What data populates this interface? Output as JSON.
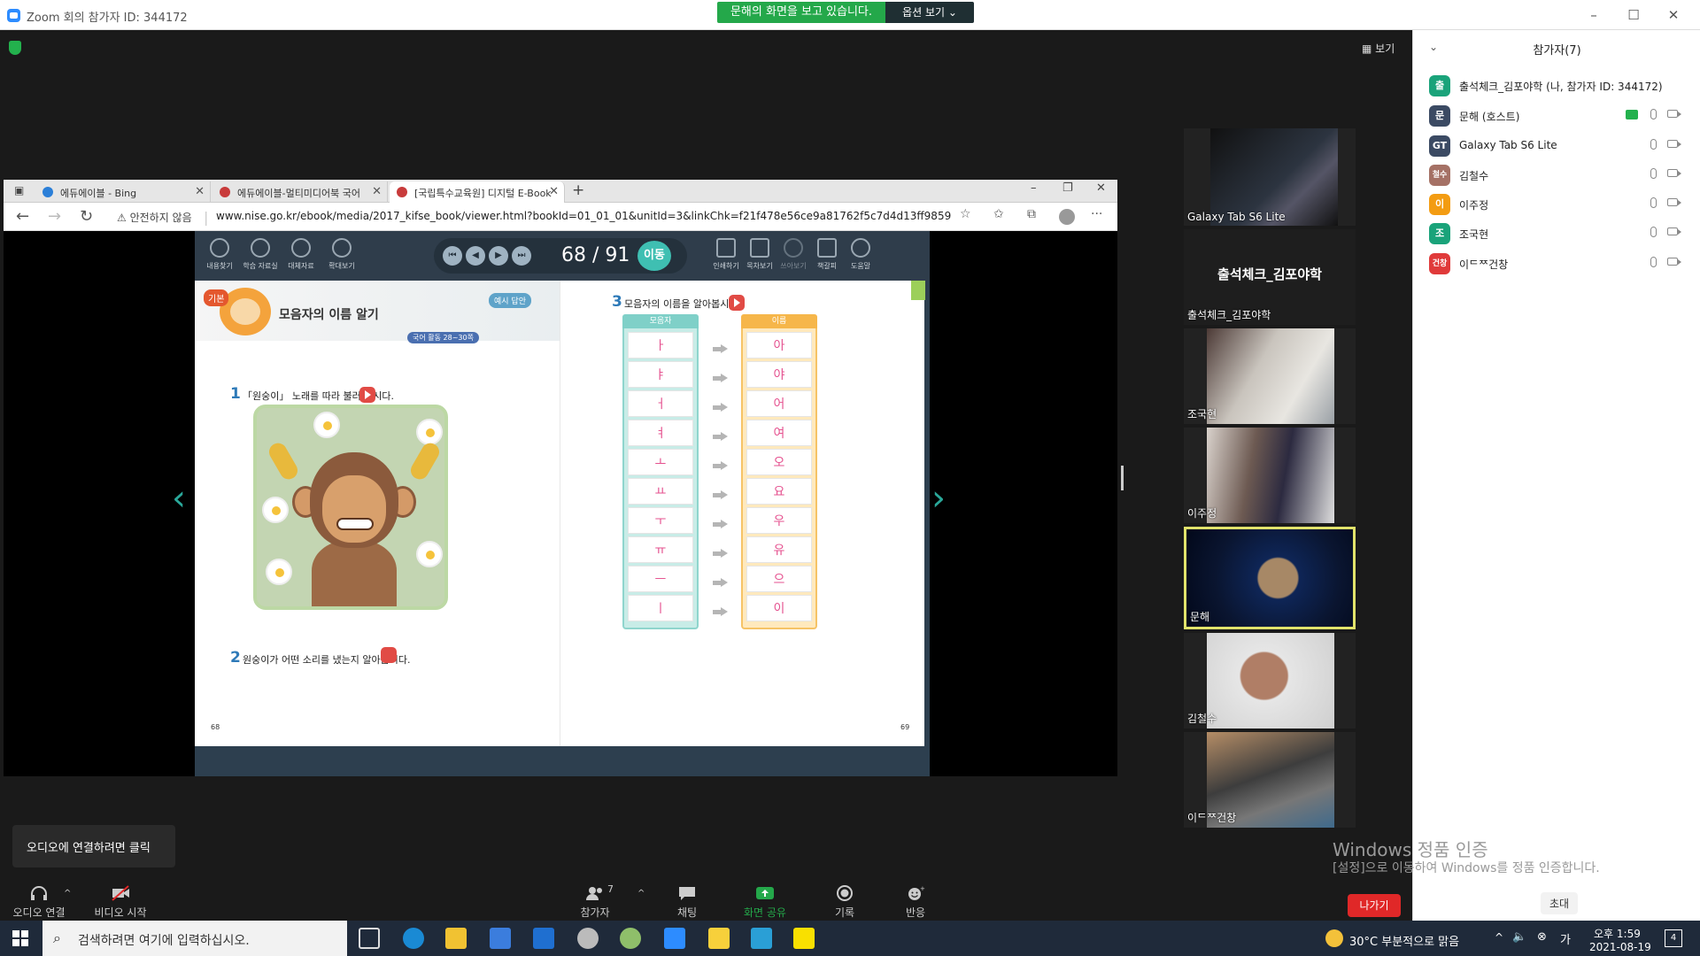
{
  "window": {
    "title": "Zoom 회의 참가자 ID: 344172",
    "share_banner": "문해의 화면을 보고 있습니다.",
    "view_options": "옵션 보기 ⌄",
    "view_label": "보기"
  },
  "browser": {
    "tabs": [
      {
        "label": "에듀에이블 - Bing"
      },
      {
        "label": "에듀에이블-멀티미디어북 국어"
      },
      {
        "label": "[국립특수교육원] 디지털 E-Book"
      }
    ],
    "security_warning": "안전하지 않음",
    "url": "www.nise.go.kr/ebook/media/2017_kifse_book/viewer.html?bookId=01_01_01&unitId=3&linkChk=f21f478e56ce9a81762f5c7d4d13ff9859507d6624cd2398f1892f..."
  },
  "ebook": {
    "tools_left": [
      "내용찾기",
      "학습 자료실",
      "대체자료",
      "확대보기"
    ],
    "tools_right": [
      "인쇄하기",
      "목차보기",
      "쓰아보기",
      "책갈피",
      "도움말"
    ],
    "page_current": "68",
    "page_total": "91",
    "page_display": "68 / 91",
    "go_label": "이동",
    "left_page": {
      "badge": "기본",
      "title": "모음자의 이름 알기",
      "answer_tag": "예시 답안",
      "hours": "국어 활동 28~30쪽",
      "q1_num": "1",
      "q1_text": "「원숭이」 노래를 따라 불러 봅시다.",
      "q2_num": "2",
      "q2_text": "원숭이가 어떤 소리를 냈는지 알아봅시다.",
      "page_no": "68"
    },
    "right_page": {
      "q3_num": "3",
      "q3_text": "모음자의 이름을 알아봅시다.",
      "col_vowel": "모음자",
      "col_name": "이름",
      "vowels": [
        "ㅏ",
        "ㅑ",
        "ㅓ",
        "ㅕ",
        "ㅗ",
        "ㅛ",
        "ㅜ",
        "ㅠ",
        "ㅡ",
        "ㅣ"
      ],
      "names": [
        "아",
        "야",
        "어",
        "여",
        "오",
        "요",
        "우",
        "유",
        "으",
        "이"
      ],
      "page_no": "69"
    }
  },
  "videos": [
    {
      "name": "Galaxy Tab S6 Lite"
    },
    {
      "name": "출석체크_김포야학",
      "big": "출석체크_김포야학"
    },
    {
      "name": "조국현"
    },
    {
      "name": "이주정"
    },
    {
      "name": "문해"
    },
    {
      "name": "김철수"
    },
    {
      "name": "이ᄃᄍ건창"
    }
  ],
  "participants": {
    "title": "참가자(7)",
    "list": [
      {
        "avatar": "출",
        "name": "출석체크_김포야학 (나, 참가자 ID: 344172)",
        "color": "#1aa37a"
      },
      {
        "avatar": "문",
        "name": "문해 (호스트)",
        "color": "#3b4a63"
      },
      {
        "avatar": "GT",
        "name": "Galaxy Tab S6 Lite",
        "color": "#3b4a63"
      },
      {
        "avatar": "철수",
        "name": "김철수",
        "color": "#a57165"
      },
      {
        "avatar": "이",
        "name": "이주정",
        "color": "#f39c12"
      },
      {
        "avatar": "조",
        "name": "조국현",
        "color": "#1aa37a"
      },
      {
        "avatar": "건창",
        "name": "이ᄃᄍ건창",
        "color": "#e03a3a"
      }
    ],
    "invite": "초대"
  },
  "audio_tip": "오디오에 연결하려면 클릭",
  "toolbar": {
    "audio": "오디오 연결",
    "video": "비디오 시작",
    "participants": "참가자",
    "participants_count": "7",
    "chat": "채팅",
    "share": "화면 공유",
    "record": "기록",
    "reactions": "반응",
    "leave": "나가기"
  },
  "windows_activation": {
    "line1": "Windows 정품 인증",
    "line2": "[설정]으로 이동하여 Windows를 정품 인증합니다."
  },
  "taskbar": {
    "search_placeholder": "검색하려면 여기에 입력하십시오.",
    "weather": "30°C 부분적으로 맑음",
    "time": "오후 1:59",
    "date": "2021-08-19",
    "notifications": "4"
  },
  "colors": {
    "zoom_green": "#24a84a",
    "ebook_teal": "#3fbfb2",
    "vowel_pink": "#e5518f",
    "leave_red": "#e02828",
    "speaker_highlight": "#e1e36b"
  }
}
